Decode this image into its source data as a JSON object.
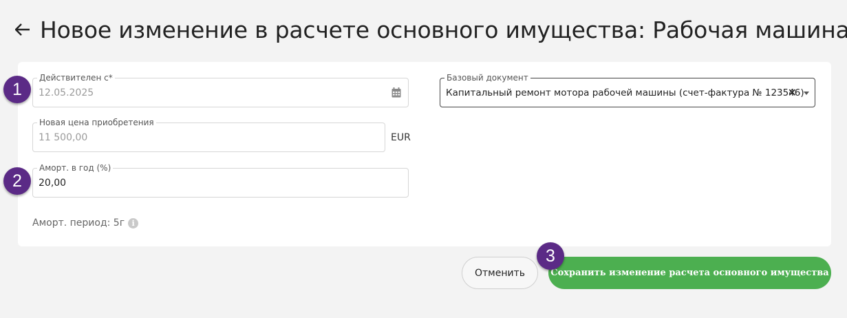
{
  "header": {
    "title": "Новое изменение в расчете основного имущества: Рабочая машина"
  },
  "form": {
    "valid_from": {
      "label": "Действителен с*",
      "value": "12.05.2025"
    },
    "new_price": {
      "label": "Новая цена приобретения",
      "value": "11 500,00",
      "unit": "EUR"
    },
    "depreciation": {
      "label": "Аморт. в год (%)",
      "value": "20,00"
    },
    "period_text": "Аморт. период: 5г",
    "base_document": {
      "label": "Базовый документ",
      "value": "Капитальный ремонт мотора рабочей машины (счет-фактура № 123546)"
    }
  },
  "buttons": {
    "cancel": "Отменить",
    "save": "Сохранить изменение расчета основного имущества"
  },
  "badges": [
    "1",
    "2",
    "3"
  ],
  "colors": {
    "accent_green": "#4caf50",
    "badge_purple": "#5b2a86"
  }
}
